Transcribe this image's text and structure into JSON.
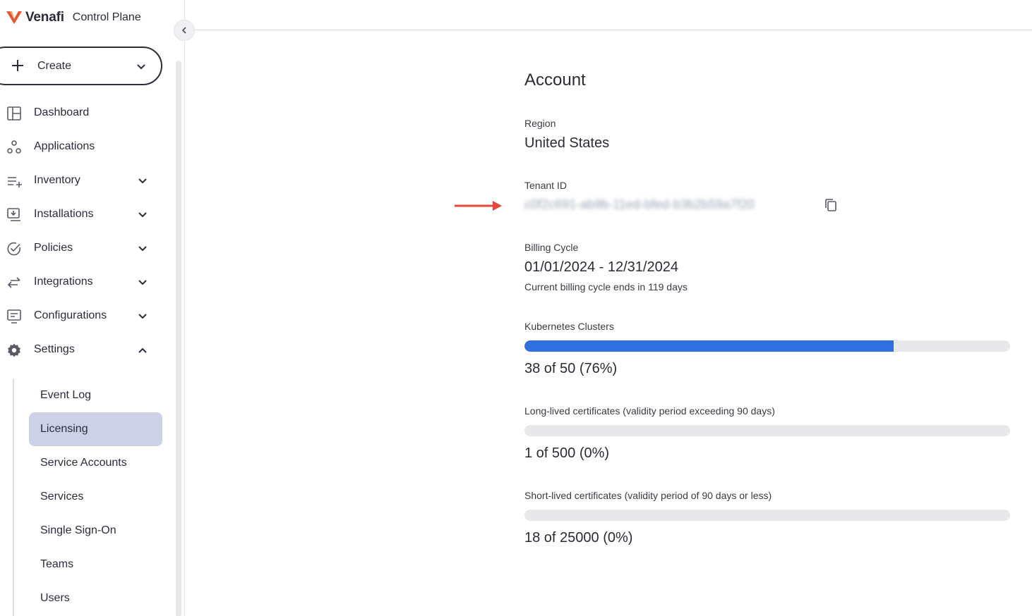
{
  "app": {
    "brand_name": "Venafi",
    "brand_sub": "Control Plane"
  },
  "sidebar": {
    "create_label": "Create",
    "items": [
      {
        "label": "Dashboard",
        "icon": "dashboard-icon",
        "expandable": false
      },
      {
        "label": "Applications",
        "icon": "applications-icon",
        "expandable": false
      },
      {
        "label": "Inventory",
        "icon": "inventory-icon",
        "expandable": true
      },
      {
        "label": "Installations",
        "icon": "installations-icon",
        "expandable": true
      },
      {
        "label": "Policies",
        "icon": "policies-icon",
        "expandable": true
      },
      {
        "label": "Integrations",
        "icon": "integrations-icon",
        "expandable": true
      },
      {
        "label": "Configurations",
        "icon": "configurations-icon",
        "expandable": true
      },
      {
        "label": "Settings",
        "icon": "gear-icon",
        "expandable": true,
        "expanded": true
      }
    ],
    "settings_items": [
      {
        "label": "Event Log"
      },
      {
        "label": "Licensing",
        "active": true
      },
      {
        "label": "Service Accounts"
      },
      {
        "label": "Services"
      },
      {
        "label": "Single Sign-On"
      },
      {
        "label": "Teams"
      },
      {
        "label": "Users"
      }
    ]
  },
  "account": {
    "title": "Account",
    "region_label": "Region",
    "region_value": "United States",
    "tenant_label": "Tenant ID",
    "tenant_value": "c0f2c691-ab9b-11ed-bfed-b3b2b59a7f20",
    "billing_label": "Billing Cycle",
    "billing_value": "01/01/2024 - 12/31/2024",
    "billing_note": "Current billing cycle ends in 119 days"
  },
  "usage": [
    {
      "label": "Kubernetes Clusters",
      "value_text": "38 of 50 (76%)",
      "fraction": 0.76
    },
    {
      "label": "Long-lived certificates (validity period exceeding 90 days)",
      "value_text": "1 of 500 (0%)",
      "fraction": 0.0
    },
    {
      "label": "Short-lived certificates (validity period of 90 days or less)",
      "value_text": "18 of 25000 (0%)",
      "fraction": 0.0
    }
  ],
  "colors": {
    "accent": "#2f6fe0",
    "active_nav": "#cdd1e8",
    "brand": "#e8542b",
    "annotation_arrow": "#e5483b"
  }
}
